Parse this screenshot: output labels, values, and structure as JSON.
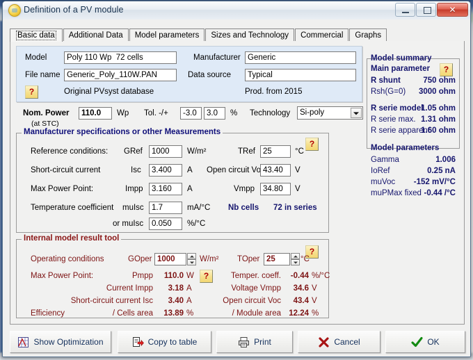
{
  "window": {
    "title": "Definition of a PV module",
    "icon": "pv-module-icon",
    "minimize_label": "–",
    "maximize_label": "□",
    "close_label": "✕"
  },
  "tabs": [
    {
      "label": "Basic data",
      "active": true
    },
    {
      "label": "Additional Data",
      "active": false
    },
    {
      "label": "Model parameters",
      "active": false
    },
    {
      "label": "Sizes and Technology",
      "active": false
    },
    {
      "label": "Commercial",
      "active": false
    },
    {
      "label": "Graphs",
      "active": false
    }
  ],
  "identification": {
    "model_label": "Model",
    "model_value": "Poly 110 Wp  72 cells",
    "filename_label": "File name",
    "filename_value": "Generic_Poly_110W.PAN",
    "manufacturer_label": "Manufacturer",
    "manufacturer_value": "Generic",
    "datasource_label": "Data source",
    "datasource_value": "Typical",
    "help_label": "?",
    "database_note": "Original PVsyst database",
    "production_note": "Prod. from 2015"
  },
  "nominal": {
    "power_label": "Nom. Power",
    "power_sub": "(at STC)",
    "power_value": "110.0",
    "power_unit": "Wp",
    "tol_label": "Tol. -/+",
    "tol_minus": "-3.0",
    "tol_plus": "3.0",
    "tol_unit": "%",
    "technology_label": "Technology",
    "technology_value": "Si-poly"
  },
  "manufacturer_specs": {
    "legend": "Manufacturer specifications  or  other Measurements",
    "help_label": "?",
    "rows": {
      "ref_cond_label": "Reference conditions:",
      "gref_label": "GRef",
      "gref_value": "1000",
      "gref_unit": "W/m²",
      "tref_label": "TRef",
      "tref_value": "25",
      "tref_unit": "°C",
      "isc_label": "Short-circuit current",
      "isc_sym": "Isc",
      "isc_value": "3.400",
      "isc_unit": "A",
      "voc_label": "Open circuit Voc",
      "voc_value": "43.40",
      "voc_unit": "V",
      "mpp_label": "Max Power Point:",
      "impp_sym": "Impp",
      "impp_value": "3.160",
      "impp_unit": "A",
      "vmpp_label": "Vmpp",
      "vmpp_value": "34.80",
      "vmpp_unit": "V",
      "tempco_label": "Temperature coefficient",
      "muisc_sym": "muIsc",
      "muisc_value": "1.7",
      "muisc_unit": "mA/°C",
      "or_muisc_sym": "or muIsc",
      "or_muisc_value": "0.050",
      "or_muisc_unit": "%/°C",
      "nbcells_label": "Nb cells",
      "nbcells_value": "72 in series"
    }
  },
  "internal_model": {
    "legend": "Internal model result tool",
    "help_label": "?",
    "oper_cond_label": "Operating conditions",
    "goper_label": "GOper",
    "goper_value": "1000",
    "goper_unit": "W/m²",
    "toper_label": "TOper",
    "toper_value": "25",
    "toper_unit": "°C",
    "mpp_label": "Max Power Point:",
    "pmpp_sym": "Pmpp",
    "pmpp_value": "110.0",
    "pmpp_unit": "W",
    "pmpp_help": "?",
    "tempco_label": "Temper. coeff.",
    "tempco_value": "-0.44",
    "tempco_unit": "%/°C",
    "impp_label": "Current Impp",
    "impp_value": "3.18",
    "impp_unit": "A",
    "vmpp_label": "Voltage Vmpp",
    "vmpp_value": "34.6",
    "vmpp_unit": "V",
    "isc_label": "Short-circuit current Isc",
    "isc_value": "3.40",
    "isc_unit": "A",
    "voc_label": "Open circuit Voc",
    "voc_value": "43.4",
    "voc_unit": "V",
    "efficiency_label": "Efficiency",
    "cells_area_label": "/ Cells area",
    "cells_area_value": "13.89",
    "cells_area_unit": "%",
    "module_area_label": "/ Module area",
    "module_area_value": "12.24",
    "module_area_unit": "%"
  },
  "model_summary": {
    "title": "Model summary",
    "main_parameter": "Main parameter",
    "help_label": "?",
    "rows": [
      {
        "label": "R shunt",
        "value": "750 ohm",
        "bold": true
      },
      {
        "label": "Rsh(G=0)",
        "value": "3000 ohm",
        "bold": false
      },
      {
        "label": "R serie model",
        "value": "1.05 ohm",
        "bold": true
      },
      {
        "label": "R serie max.",
        "value": "1.31 ohm",
        "bold": false
      },
      {
        "label": "R serie apparent",
        "value": "1.60 ohm",
        "bold": false
      }
    ],
    "params_title": "Model parameters",
    "params": [
      {
        "label": "Gamma",
        "value": "1.006"
      },
      {
        "label": "IoRef",
        "value": "0.25 nA"
      },
      {
        "label": "muVoc",
        "value": "-152 mV/°C"
      },
      {
        "label": "muPMax fixed",
        "value": "-0.44 /°C"
      }
    ]
  },
  "buttons": [
    {
      "label": "Show Optimization",
      "icon": "chart-icon"
    },
    {
      "label": "Copy to table",
      "icon": "copy-icon"
    },
    {
      "label": "Print",
      "icon": "printer-icon"
    },
    {
      "label": "Cancel",
      "icon": "cross-icon"
    },
    {
      "label": "OK",
      "icon": "check-icon"
    }
  ],
  "colors": {
    "accent_navy": "#16166e",
    "accent_maroon": "#7d1414",
    "panel_blue": "#dfeaf7",
    "close_red": "#c63b2b"
  }
}
